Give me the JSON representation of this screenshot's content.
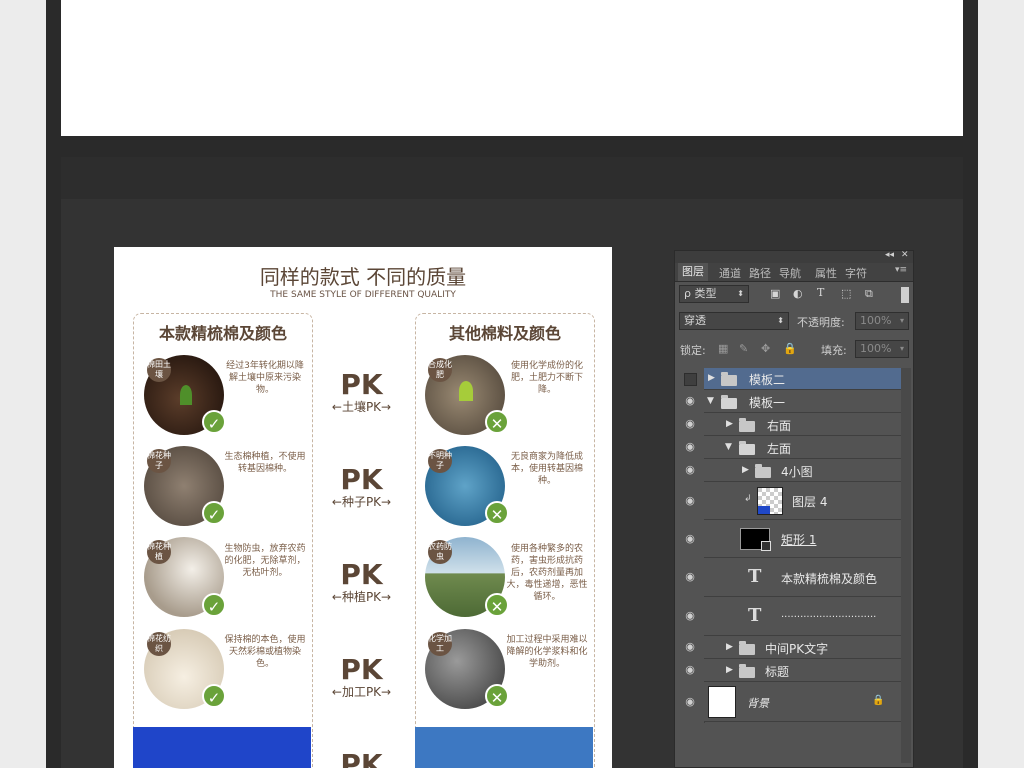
{
  "document": {
    "title": "同样的款式  不同的质量",
    "subtitle": "THE SAME STYLE OF DIFFERENT QUALITY",
    "left_heading": "本款精梳棉及颜色",
    "right_heading": "其他棉料及颜色",
    "left_items": [
      {
        "tag": "棉田土壤",
        "desc": "经过3年转化期以降解土壤中原来污染物。"
      },
      {
        "tag": "棉花种子",
        "desc": "生态棉种植，不使用转基因棉种。"
      },
      {
        "tag": "棉花种植",
        "desc": "生物防虫，放弃农药的化肥，无除草剂，无枯叶剂。"
      },
      {
        "tag": "棉花纺织",
        "desc": "保持棉的本色，使用天然彩棉或植物染色。"
      }
    ],
    "right_items": [
      {
        "tag": "合成化肥",
        "desc": "使用化学成份的化肥，土肥力不断下降。"
      },
      {
        "tag": "不明种子",
        "desc": "无良商家为降低成本，使用转基因棉种。"
      },
      {
        "tag": "农药防虫",
        "desc": "使用各种繁多的农药，害虫形成抗药后，农药剂量再加大，毒性递增，恶性循环。"
      },
      {
        "tag": "化学加工",
        "desc": "加工过程中采用难以降解的化学浆料和化学助剂。"
      }
    ],
    "pk_items": [
      {
        "big": "PK",
        "small": "←土壤PK→"
      },
      {
        "big": "PK",
        "small": "←种子PK→"
      },
      {
        "big": "PK",
        "small": "←种植PK→"
      },
      {
        "big": "PK",
        "small": "←加工PK→"
      },
      {
        "big": "PK",
        "small": ""
      }
    ],
    "check_icon": "check-icon",
    "cross_icon": "cross-icon",
    "colors": {
      "brown": "#5b4636",
      "green": "#6aa23a",
      "swatch_left": "#1f45c9",
      "swatch_right": "#3d78c2"
    }
  },
  "panel": {
    "tabs": [
      "图层",
      "通道",
      "路径",
      "导航",
      "属性",
      "字符"
    ],
    "filter_label": "ρ 类型",
    "blend_mode": "穿透",
    "opacity_label": "不透明度:",
    "opacity_value": "100%",
    "lock_label": "锁定:",
    "fill_label": "填充:",
    "fill_value": "100%",
    "collapse_label": "◂◂",
    "close_label": "✕",
    "menu_label": "▾≡",
    "layers": [
      {
        "name": "模板二",
        "type": "group",
        "expanded": false,
        "selected": true,
        "visible": false
      },
      {
        "name": "模板一",
        "type": "group",
        "expanded": true,
        "visible": true
      },
      {
        "name": "右面",
        "type": "group",
        "expanded": false,
        "visible": true
      },
      {
        "name": "左面",
        "type": "group",
        "expanded": true,
        "visible": true
      },
      {
        "name": "4小图",
        "type": "group",
        "expanded": false,
        "visible": true
      },
      {
        "name": "图层 4",
        "type": "pixel",
        "visible": true
      },
      {
        "name": "矩形 1",
        "type": "shape",
        "visible": true
      },
      {
        "name": "本款精梳棉及颜色",
        "type": "text",
        "visible": true
      },
      {
        "name": "..............................",
        "type": "text",
        "visible": true
      },
      {
        "name": "中间PK文字",
        "type": "group",
        "expanded": false,
        "visible": true
      },
      {
        "name": "标题",
        "type": "group",
        "expanded": false,
        "visible": true
      },
      {
        "name": "背景",
        "type": "background",
        "locked": true,
        "visible": true
      }
    ]
  }
}
